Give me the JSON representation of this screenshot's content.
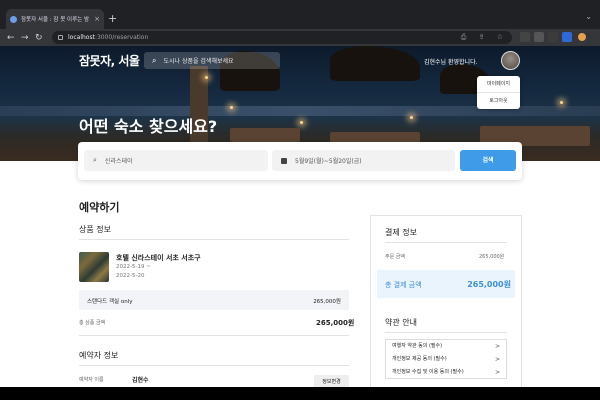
{
  "browser": {
    "tab_title": "잠못자 서울 : 잠 못 이루는 밤",
    "url_host": "localhost",
    "url_path": ":3000/reservation"
  },
  "header": {
    "logo": "잠못자, 서울",
    "search_placeholder": "도시나 상품을 검색해보세요",
    "welcome": "김현수님 환영합니다.",
    "menu": [
      "마이페이지",
      "로그아웃"
    ]
  },
  "hero": {
    "title": "어떤 숙소 찾으세요?"
  },
  "search": {
    "location": "신라스테이",
    "dates": "5월9일(월)~5월20일(금)",
    "button": "검색"
  },
  "reservation": {
    "title": "예약하기",
    "product_section": "상품 정보",
    "hotel_name": "호텔 신라스테이 서초 서초구",
    "date_start": "2022-5-19 ~",
    "date_end": "2022-5-20",
    "room_name": "스탠다드 객실 only",
    "room_price": "265,000원",
    "total_label": "총 상품 금액",
    "total_value": "265,000원",
    "booker_section": "예약자 정보",
    "booker_label": "예약자 이름",
    "booker_name": "김현수",
    "edit_button": "정보변경"
  },
  "payment": {
    "title": "결제 정보",
    "order_label": "주문 금액",
    "order_value": "265,000원",
    "total_label": "총 결제 금액",
    "total_value": "265,000원"
  },
  "terms": {
    "title": "약관 안내",
    "items": [
      "여행자 약관 동의 (필수)",
      "개인정보 제공 동의 (필수)",
      "개인정보 수집 및 이용 동의 (필수)"
    ],
    "arrow": ">"
  }
}
